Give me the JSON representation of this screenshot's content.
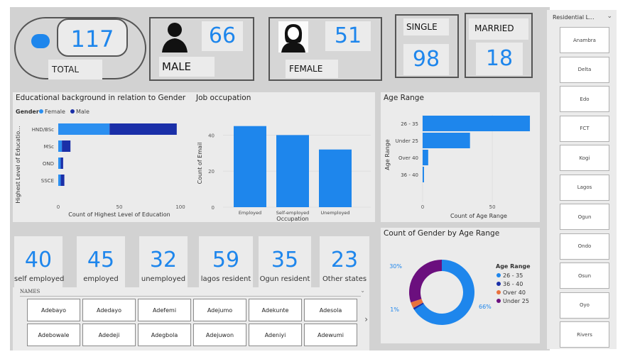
{
  "kpis": {
    "total": {
      "value": "117",
      "label": "TOTAL"
    },
    "male": {
      "value": "66",
      "label": "MALE"
    },
    "female": {
      "value": "51",
      "label": "FEMALE"
    },
    "single": {
      "value": "98",
      "label": "SINGLE"
    },
    "married": {
      "value": "18",
      "label": "MARRIED"
    }
  },
  "stats": [
    {
      "value": "40",
      "label": "self employed"
    },
    {
      "value": "45",
      "label": "employed"
    },
    {
      "value": "32",
      "label": "unemployed"
    },
    {
      "value": "59",
      "label": "lagos resident"
    },
    {
      "value": "35",
      "label": "Ogun resident"
    },
    {
      "value": "23",
      "label": "Other states"
    }
  ],
  "names_slicer": {
    "title": "NAMES",
    "names": [
      "Adebayo",
      "Adedayo",
      "Adefemi",
      "Adejumo",
      "Adekunte",
      "Adesola",
      "Adebowale",
      "Adedeji",
      "Adegbola",
      "Adejuwon",
      "Adeniyi",
      "Adewumi"
    ]
  },
  "residential_slicer": {
    "title": "Residential L...",
    "items": [
      "Anambra",
      "Delta",
      "Edo",
      "FCT",
      "Kogi",
      "Lagos",
      "Ogun",
      "Ondo",
      "Osun",
      "Oyo",
      "Rivers"
    ]
  },
  "colors": {
    "accent": "#1e86ec",
    "female": "#2b8ff0",
    "male": "#1a2fa8",
    "over40": "#e9713c",
    "under25": "#6b0f7e"
  },
  "chart_data": [
    {
      "type": "bar",
      "orientation": "horizontal",
      "stacked": true,
      "title": "Educational background in relation to Gender",
      "legend_title": "Gender",
      "legend_position": "top-left",
      "categories": [
        "HND/BSc",
        "MSc",
        "OND",
        "SSCE"
      ],
      "series": [
        {
          "name": "Female",
          "values": [
            42,
            3,
            2,
            2
          ]
        },
        {
          "name": "Male",
          "values": [
            55,
            7,
            2,
            3
          ]
        }
      ],
      "xlabel": "Count of Highest Level of Education",
      "ylabel": "Highest Level of Educatio...",
      "xlim": [
        0,
        100
      ],
      "xticks": [
        "0",
        "50",
        "100"
      ]
    },
    {
      "type": "bar",
      "title": "Job occupation",
      "categories": [
        "Employed",
        "Self-employed",
        "Unemployed"
      ],
      "values": [
        45,
        40,
        32
      ],
      "xlabel": "Occupation",
      "ylabel": "Count of Email",
      "ylim": [
        0,
        50
      ],
      "yticks": [
        "0",
        "20",
        "40"
      ]
    },
    {
      "type": "bar",
      "orientation": "horizontal",
      "title": "Age Range",
      "categories": [
        "26 - 35",
        "Under 25",
        "Over 40",
        "36 - 40"
      ],
      "values": [
        77,
        34,
        4,
        1
      ],
      "xlabel": "Count of Age Range",
      "ylabel": "Age Range",
      "xlim": [
        0,
        78
      ],
      "xticks": [
        "0",
        "50"
      ]
    },
    {
      "type": "pie",
      "donut": true,
      "title": "Count of Gender by Age Range",
      "legend_title": "Age Range",
      "legend_position": "right",
      "labels": [
        "26 - 35",
        "36 - 40",
        "Over 40",
        "Under 25"
      ],
      "values": [
        66,
        1,
        3,
        30
      ],
      "data_labels": [
        "66%",
        "",
        "1%",
        "30%"
      ]
    }
  ]
}
